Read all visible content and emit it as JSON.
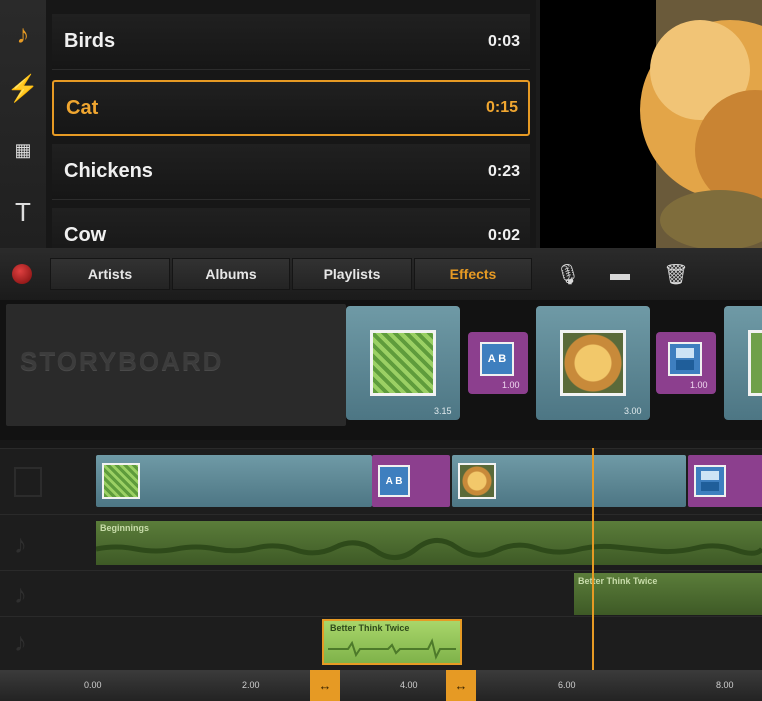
{
  "tools": [
    {
      "name": "music-note-icon",
      "glyph": "♪"
    },
    {
      "name": "lightning-icon",
      "glyph": "⚡"
    },
    {
      "name": "overlay-icon",
      "glyph": "▦"
    },
    {
      "name": "text-icon",
      "glyph": "T"
    }
  ],
  "sounds": [
    {
      "name": "Birds",
      "duration": "0:03"
    },
    {
      "name": "Cat",
      "duration": "0:15"
    },
    {
      "name": "Chickens",
      "duration": "0:23"
    },
    {
      "name": "Cow",
      "duration": "0:02"
    }
  ],
  "tabs": {
    "artists": "Artists",
    "albums": "Albums",
    "playlists": "Playlists",
    "effects": "Effects"
  },
  "toolbar_icons": {
    "mic": "🎙",
    "film": "▬",
    "trash": "🗑"
  },
  "storyboard": {
    "label": "STORYBOARD",
    "clip1_time": "3.15",
    "trans1_time": "1.00",
    "clip2_time": "3.00",
    "trans2_time": "1.00",
    "trans_letters": "A B"
  },
  "audio": {
    "track1_label": "Beginnings",
    "track2_label": "Better Think Twice",
    "track3_label": "Better Think Twice"
  },
  "ruler": {
    "t0": "0.00",
    "t2": "2.00",
    "t4": "4.00",
    "t6": "6.00",
    "t8": "8.00",
    "handle_glyph": "↔"
  },
  "colors": {
    "accent": "#e69a24",
    "clip": "#5e8a97",
    "transition": "#8c3f8e",
    "audio": "#5b7d3a"
  }
}
